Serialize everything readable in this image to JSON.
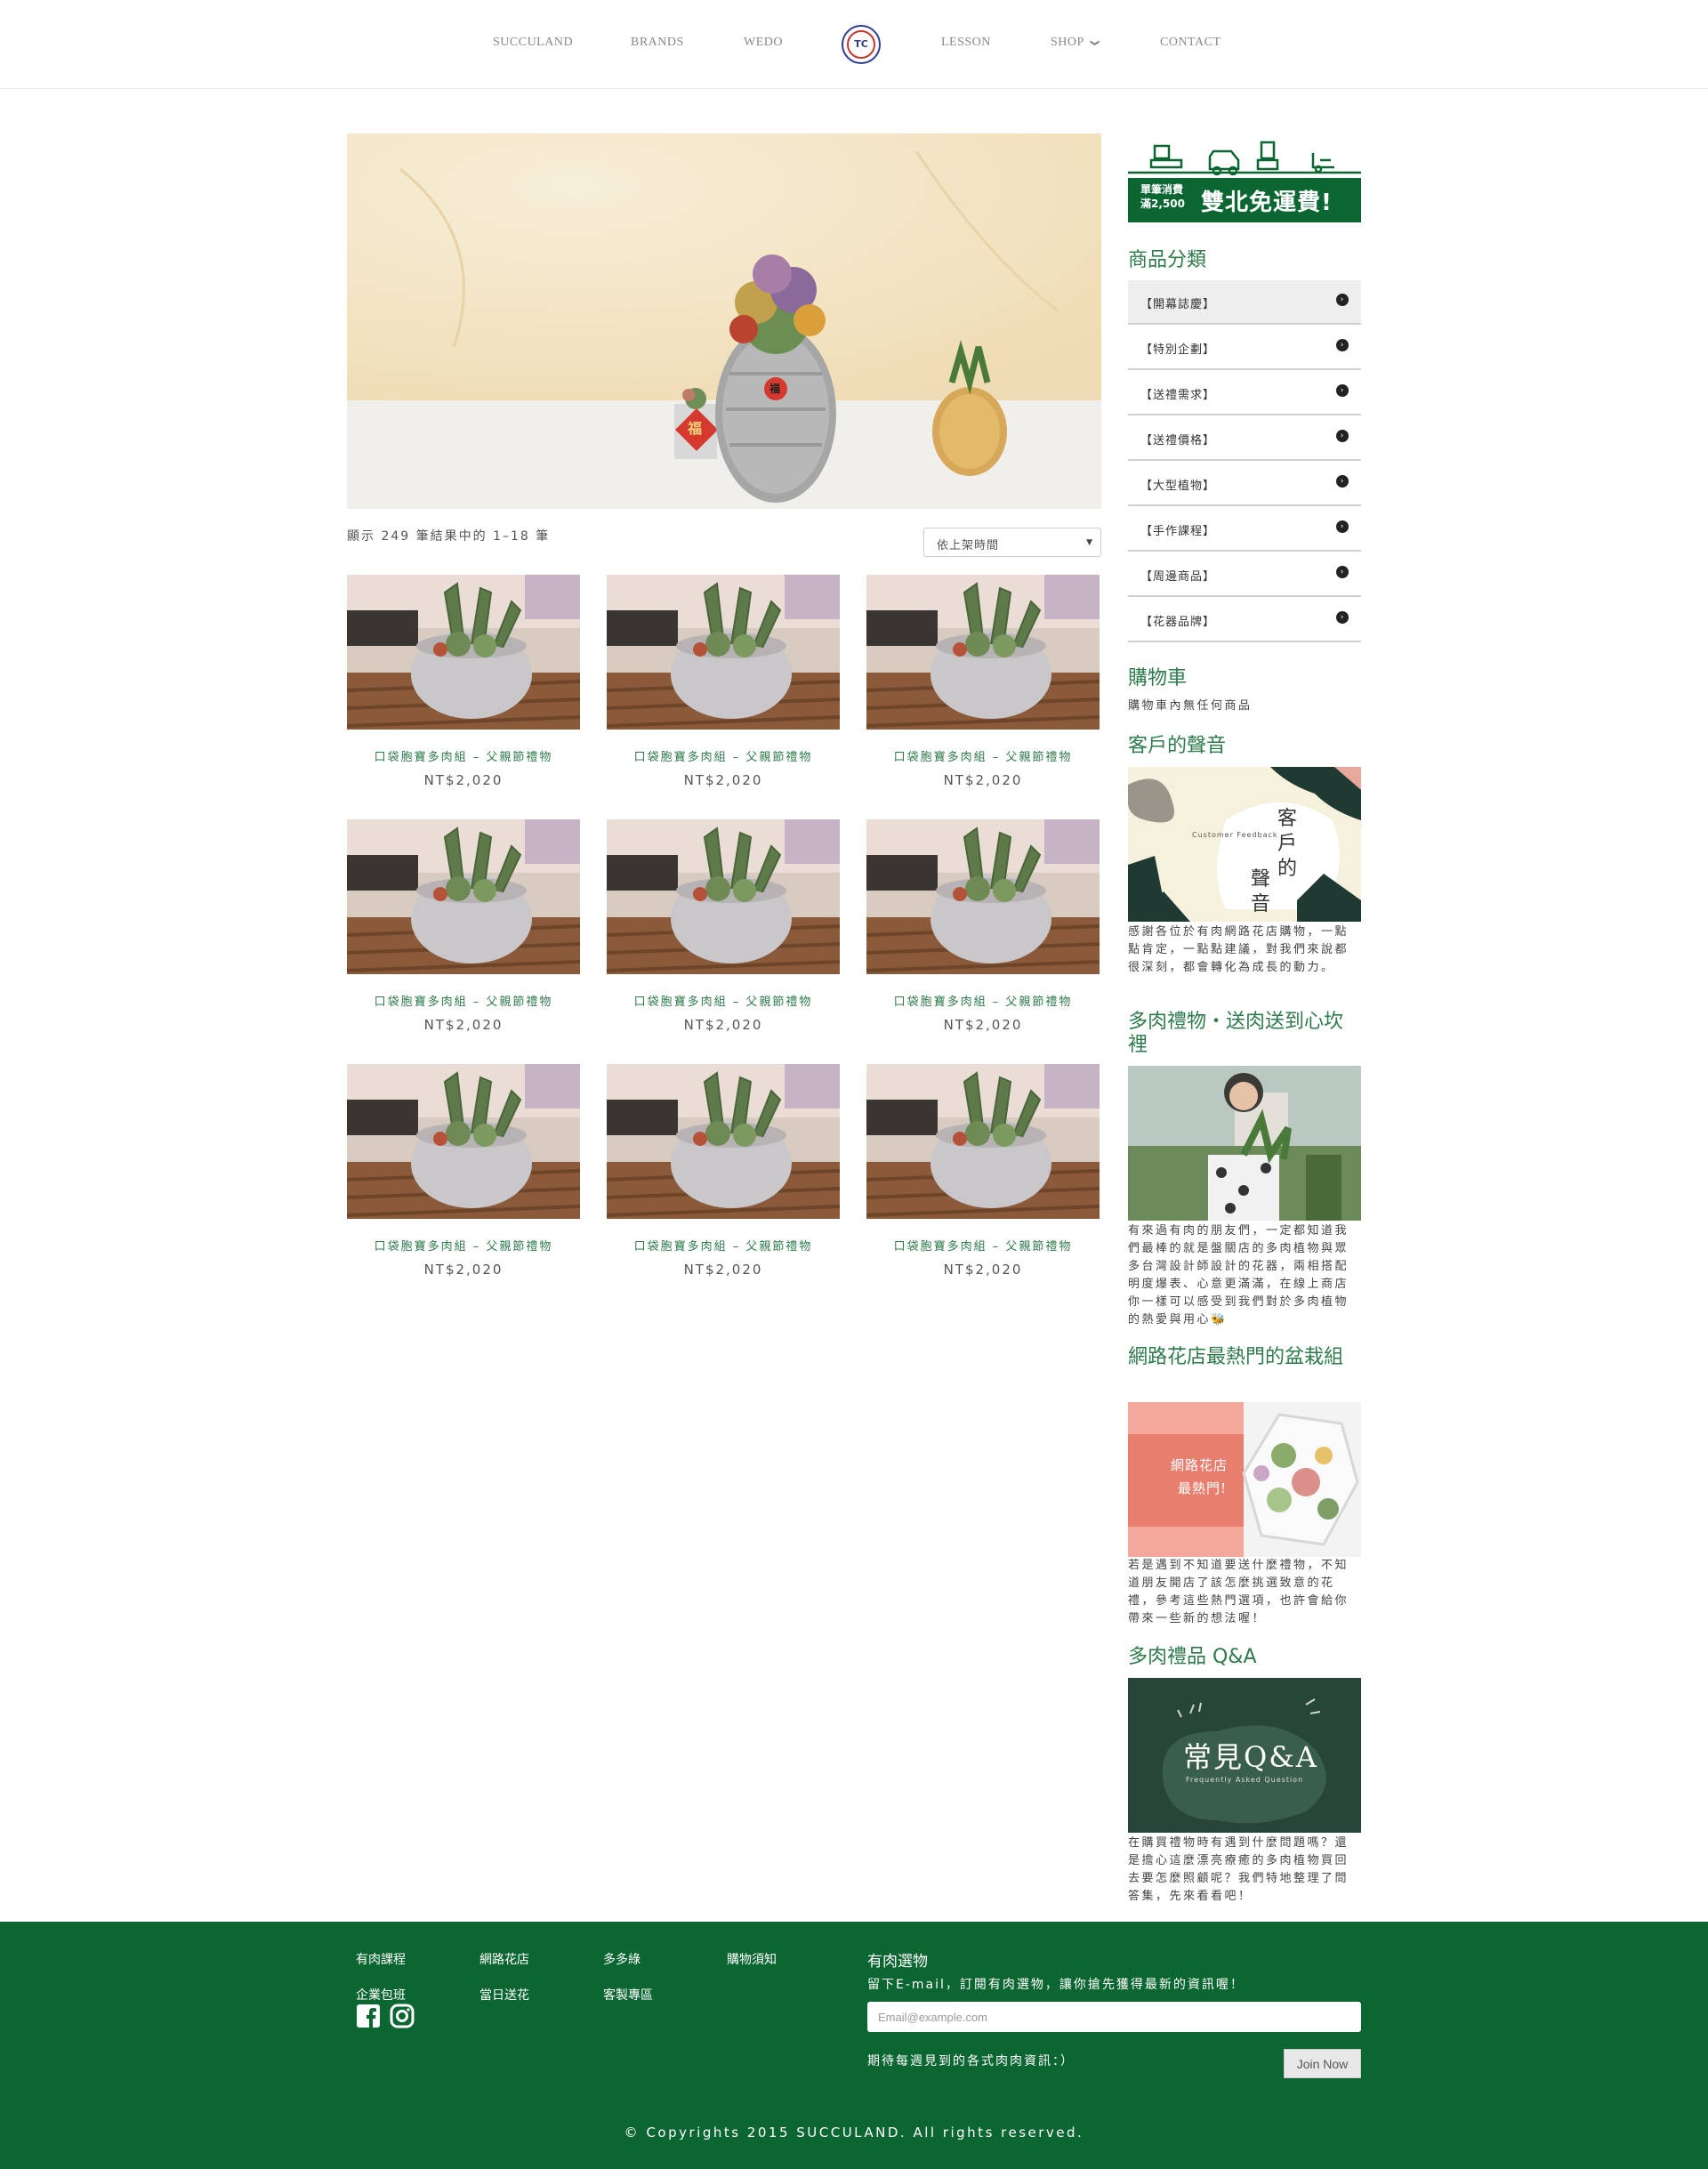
{
  "nav": {
    "items": [
      "SUCCULAND",
      "BRANDS",
      "WEDO",
      "LESSON",
      "SHOP",
      "CONTACT"
    ],
    "shop_caret": "❯",
    "logo_text": "TC"
  },
  "hero": {
    "pot_badge": "福",
    "pineapple_badge": "福"
  },
  "toolbar": {
    "result_count": "顯示 249 筆結果中的 1–18 筆",
    "sort_selected": "依上架時間"
  },
  "products": [
    {
      "name": "口袋胞寶多肉組 – 父親節禮物",
      "price": "NT$2,020"
    },
    {
      "name": "口袋胞寶多肉組 – 父親節禮物",
      "price": "NT$2,020"
    },
    {
      "name": "口袋胞寶多肉組 – 父親節禮物",
      "price": "NT$2,020"
    },
    {
      "name": "口袋胞寶多肉組 – 父親節禮物",
      "price": "NT$2,020"
    },
    {
      "name": "口袋胞寶多肉組 – 父親節禮物",
      "price": "NT$2,020"
    },
    {
      "name": "口袋胞寶多肉組 – 父親節禮物",
      "price": "NT$2,020"
    },
    {
      "name": "口袋胞寶多肉組 – 父親節禮物",
      "price": "NT$2,020"
    },
    {
      "name": "口袋胞寶多肉組 – 父親節禮物",
      "price": "NT$2,020"
    },
    {
      "name": "口袋胞寶多肉組 – 父親節禮物",
      "price": "NT$2,020"
    }
  ],
  "sidebar": {
    "promo": {
      "small_line1": "單筆消費",
      "small_line2": "滿2,500",
      "big": "雙北免運費!"
    },
    "categories_title": "商品分類",
    "categories": [
      "【開幕誌慶】",
      "【特別企劃】",
      "【送禮需求】",
      "【送禮價格】",
      "【大型植物】",
      "【手作課程】",
      "【周邊商品】",
      "【花器品牌】"
    ],
    "cart_title": "購物車",
    "cart_empty": "購物車內無任何商品",
    "feedback_title": "客戶的聲音",
    "feedback_img_en": "Customer Feedback",
    "feedback_img_zh1": "客",
    "feedback_img_zh2": "戶",
    "feedback_img_zh3": "的",
    "feedback_img_zh4": "聲",
    "feedback_img_zh5": "音",
    "feedback_text": "感謝各位於有肉網路花店購物，一點點肯定，一點點建議，對我們來說都很深刻，都會轉化為成長的動力。",
    "gift_title": "多肉禮物・送肉送到心坎裡",
    "gift_text": "有來過有肉的朋友們，一定都知道我們最棒的就是盤關店的多肉植物與眾多台灣設計師設計的花器，兩相搭配明度爆表、心意更滿滿，在線上商店你一樣可以感受到我們對於多肉植物的熱愛與用心🐝",
    "popular_title": "網路花店最熱門的盆栽組",
    "popular_img_line1": "網路花店",
    "popular_img_line2": "最熱門!",
    "popular_text": "若是遇到不知道要送什麼禮物，不知道朋友開店了該怎麼挑選致意的花禮，參考這些熱門選項，也許會給你帶來一些新的想法喔！",
    "qa_title": "多肉禮品 Q&A",
    "qa_img_title": "常見Q&A",
    "qa_img_sub": "Frequently Asked Question",
    "qa_text": "在購買禮物時有遇到什麼問題嗎？還是擔心這麼漂亮療癒的多肉植物買回去要怎麼照顧呢？我們特地整理了問答集，先來看看吧！"
  },
  "footer": {
    "links": [
      "有肉課程",
      "網路花店",
      "多多綠",
      "購物須知",
      "企業包班",
      "當日送花",
      "客製專區"
    ],
    "newsletter_title": "有肉選物",
    "newsletter_desc": "留下E-mail，訂閱有肉選物，讓你搶先獲得最新的資訊喔！",
    "email_placeholder": "Email@example.com",
    "newsletter_note": "期待每週見到的各式肉肉資訊：）",
    "join_label": "Join Now",
    "copyright": "© Copyrights 2015 SUCCULAND. All rights reserved."
  },
  "colors": {
    "brand_green": "#0b6631",
    "title_green": "#2e7a4b"
  }
}
